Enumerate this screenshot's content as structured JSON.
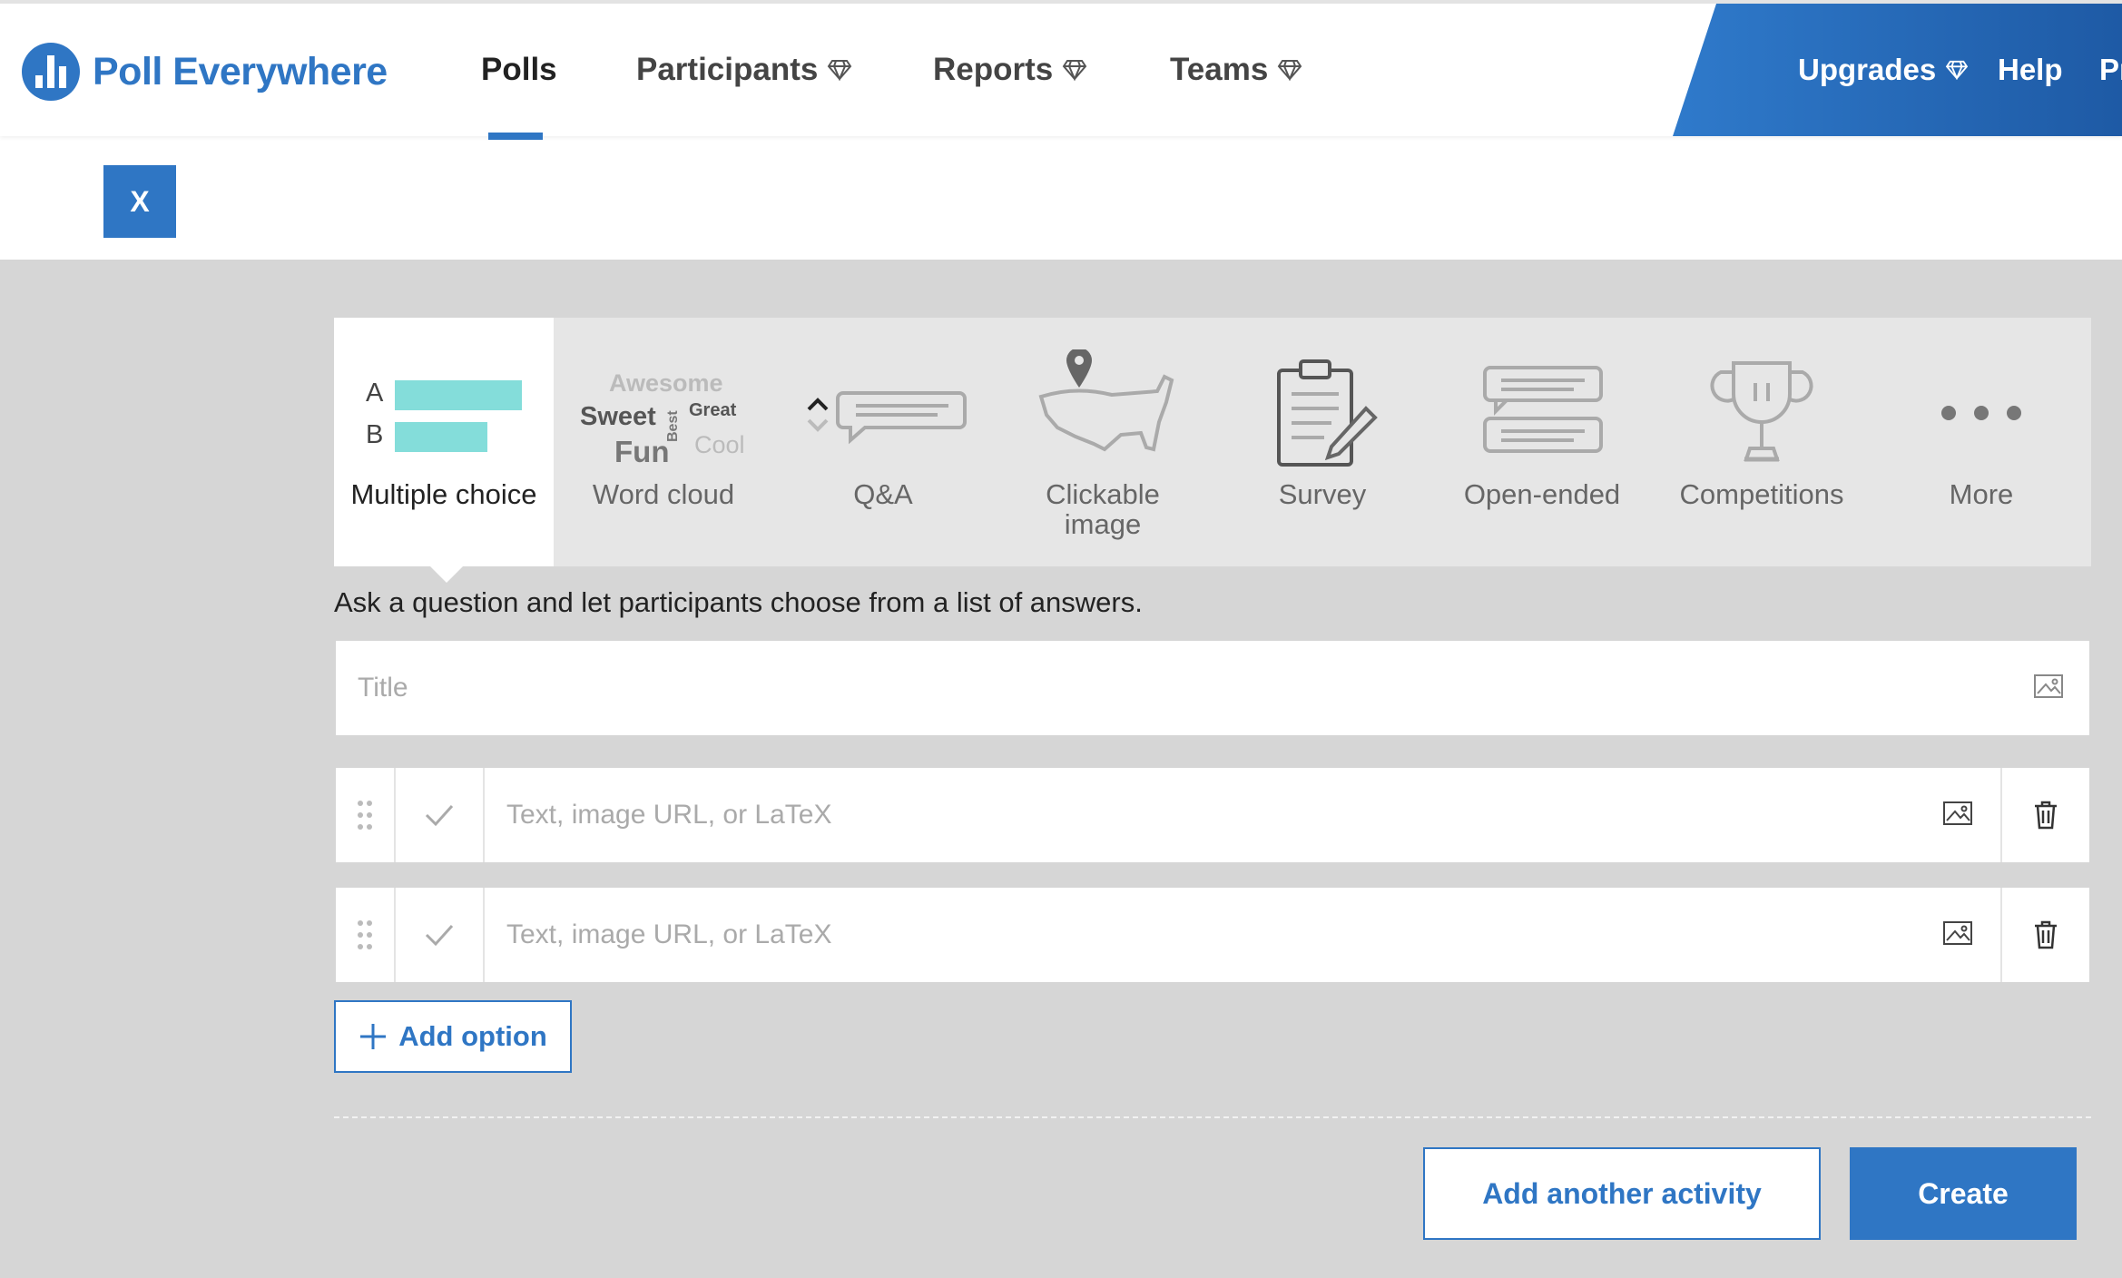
{
  "brand": {
    "name": "Poll Everywhere",
    "logo_icon": "poll-everywhere-logo-icon",
    "color": "#2f76c4"
  },
  "nav": {
    "polls": "Polls",
    "participants": "Participants",
    "reports": "Reports",
    "teams": "Teams",
    "premium_icon": "diamond-icon"
  },
  "account": {
    "upgrades": "Upgrades",
    "help": "Help",
    "profile_truncated": "Pr"
  },
  "close_button": "X",
  "activity_types": {
    "multiple_choice": {
      "label": "Multiple choice",
      "row_a": "A",
      "row_b": "B",
      "bar_color": "#84ddda"
    },
    "word_cloud": {
      "label": "Word cloud",
      "words": [
        "Awesome",
        "Sweet",
        "Best",
        "Great",
        "Fun",
        "Cool"
      ]
    },
    "qa": {
      "label": "Q&A"
    },
    "clickable_image": {
      "label_line1": "Clickable",
      "label_line2": "image"
    },
    "survey": {
      "label": "Survey"
    },
    "open_ended": {
      "label": "Open-ended"
    },
    "competitions": {
      "label": "Competitions"
    },
    "more": {
      "label": "More"
    }
  },
  "description": "Ask a question and let participants choose from a list of answers.",
  "title_field": {
    "placeholder": "Title",
    "value": ""
  },
  "options": [
    {
      "placeholder": "Text, image URL, or LaTeX",
      "value": ""
    },
    {
      "placeholder": "Text, image URL, or LaTeX",
      "value": ""
    }
  ],
  "add_option": "Add option",
  "footer": {
    "add_another": "Add another activity",
    "create": "Create"
  }
}
